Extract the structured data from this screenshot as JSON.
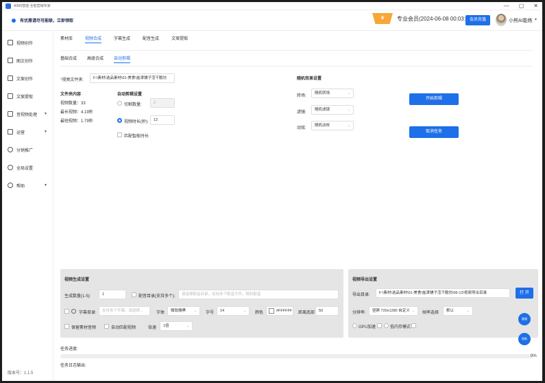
{
  "window": {
    "title": "AIMS智能 全能营销专家",
    "controls": [
      "—",
      "▢",
      "✕"
    ]
  },
  "header": {
    "notice": "有优惠请尽可能联，立即领取",
    "vip_label": "专业会员(2024-06-08 00:03:59)",
    "renew_button": "会员充值",
    "username": "小熊AI能练"
  },
  "sidebar": {
    "items": [
      {
        "label": "视频创作",
        "icon": "video-icon",
        "expandable": false
      },
      {
        "label": "图文创作",
        "icon": "image-text-icon",
        "expandable": false
      },
      {
        "label": "文案创作",
        "icon": "doc-icon",
        "expandable": false
      },
      {
        "label": "文案提取",
        "icon": "extract-icon",
        "expandable": false
      },
      {
        "label": "音视频处理",
        "icon": "media-icon",
        "expandable": true
      },
      {
        "label": "运营",
        "icon": "operation-icon",
        "expandable": true
      },
      {
        "label": "分销推广",
        "icon": "share-icon",
        "expandable": false
      },
      {
        "label": "全局设置",
        "icon": "settings-icon",
        "expandable": false
      },
      {
        "label": "帮助",
        "icon": "help-icon",
        "expandable": true
      }
    ],
    "version": "版本号：1.1.5"
  },
  "tabs": [
    {
      "label": "素材库",
      "active": false
    },
    {
      "label": "视频合成",
      "active": true
    },
    {
      "label": "字幕生成",
      "active": false
    },
    {
      "label": "配音生成",
      "active": false
    },
    {
      "label": "文案提取",
      "active": false
    }
  ],
  "subtabs": [
    {
      "label": "基础合成",
      "active": false
    },
    {
      "label": "高级合成",
      "active": false
    },
    {
      "label": "自动剪辑",
      "active": true
    }
  ],
  "source": {
    "folder_label": "视频文件夹",
    "folder_value": "F:\\素材\\选品素材\\01-美食\\盐津铺子活干脆坊",
    "stats_title": "文件夹内容",
    "video_count": "视频数量：33",
    "max_duration": "最长视频：4.19秒",
    "min_duration": "最短视频：1.79秒"
  },
  "auto_edit": {
    "title": "自动剪辑设置",
    "opt_segments": "切割数量:",
    "opt_segments_value": "2",
    "opt_duration": "视频时长(秒):",
    "opt_duration_value": "12",
    "opt_smart": "匹配智能时长"
  },
  "effects": {
    "title": "随机效果设置",
    "transition_label": "转场:",
    "transition_value": "随机转场",
    "filter_label": "滤镜:",
    "filter_value": "随机滤镜",
    "animation_label": "动效:",
    "animation_value": "随机动效"
  },
  "actions": {
    "start": "开始剪辑",
    "cancel": "取消任务"
  },
  "gen_settings": {
    "title": "视频生成设置",
    "count_label": "生成数量(1-5):",
    "count_value": "1",
    "bgm_label": "配音目录(支持多个):",
    "bgm_placeholder": "请选择配音目录，支持多个配音文件，随机配音",
    "subtitle_label": "字幕目录:",
    "subtitle_placeholder": "支持多个字幕，请选择...",
    "font_label": "字体",
    "font_value": "微软雅黑",
    "size_label": "字号",
    "size_value": "14",
    "color_label": "颜色",
    "color_value": "#FFFFFF",
    "spacing_label": "距离底部",
    "spacing_value": "50",
    "keep_audio": "保留素材音频",
    "auto_fit": "自动匹配视频",
    "speed_label": "倍速",
    "speed_value": "1倍"
  },
  "export": {
    "title": "视频导出设置",
    "dir_label": "导出目录:",
    "dir_value": "F:\\素材\\选品素材\\01-美食\\盐津铺子活干脆坊\\06-12\\视频导出目录",
    "open_button": "打 开",
    "res_label": "分辨率:",
    "res_value": "竖屏 720x1280 自定义",
    "fps_label": "帧率选择",
    "fps_value": "默认",
    "gpu_label": "GPU加速",
    "lowmem_label": "低内存模式"
  },
  "progress": {
    "label": "任务进度:",
    "percent": "0%",
    "log_label": "任务日志输出:"
  },
  "floating": {
    "service": "客服",
    "help": "帮助"
  }
}
